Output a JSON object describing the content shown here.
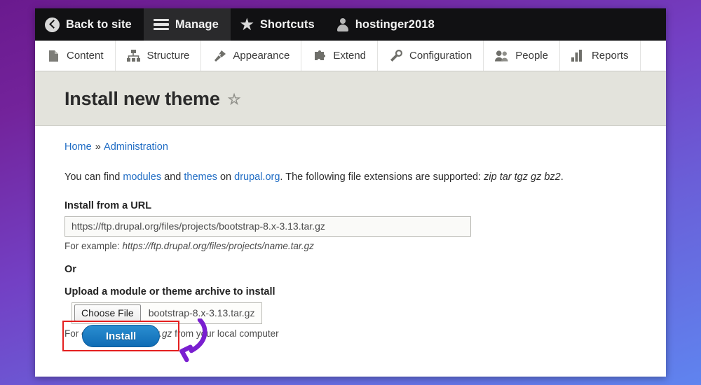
{
  "background": {
    "gradient_from": "#6a1a8e",
    "gradient_to": "#5f84ef"
  },
  "toolbar": {
    "items": [
      {
        "label": "Back to site",
        "icon": "back-arrow-icon",
        "active": false
      },
      {
        "label": "Manage",
        "icon": "hamburger-menu-icon",
        "active": true
      },
      {
        "label": "Shortcuts",
        "icon": "star-icon",
        "active": false
      },
      {
        "label": "hostinger2018",
        "icon": "user-account-icon",
        "active": false
      }
    ]
  },
  "admin_menu": {
    "items": [
      {
        "label": "Content",
        "icon": "document-icon"
      },
      {
        "label": "Structure",
        "icon": "sitemap-icon"
      },
      {
        "label": "Appearance",
        "icon": "paintbrush-icon"
      },
      {
        "label": "Extend",
        "icon": "puzzle-piece-icon"
      },
      {
        "label": "Configuration",
        "icon": "wrench-icon"
      },
      {
        "label": "People",
        "icon": "people-icon"
      },
      {
        "label": "Reports",
        "icon": "bar-chart-icon"
      }
    ]
  },
  "page": {
    "title": "Install new theme",
    "favorite_icon": "star-outline-icon"
  },
  "breadcrumb": {
    "home": "Home",
    "separator": "»",
    "current": "Administration"
  },
  "intro": {
    "part1": "You can find ",
    "link_modules": "modules",
    "part2": " and ",
    "link_themes": "themes",
    "part3": " on ",
    "link_drupal": "drupal.org",
    "part4": ". The following file extensions are supported: ",
    "extensions": "zip tar tgz gz bz2",
    "period": "."
  },
  "url_field": {
    "label": "Install from a URL",
    "value": "https://ftp.drupal.org/files/projects/bootstrap-8.x-3.13.tar.gz",
    "placeholder": "https://ftp.drupal.org/files/projects/name.tar.gz",
    "help_prefix": "For example: ",
    "help_example": "https://ftp.drupal.org/files/projects/name.tar.gz"
  },
  "or_label": "Or",
  "upload_field": {
    "label": "Upload a module or theme archive to install",
    "button_label": "Choose File",
    "filename": "bootstrap-8.x-3.13.tar.gz",
    "help_prefix": "For example: ",
    "help_example": "name.tar.gz",
    "help_suffix": " from your local computer"
  },
  "install_button": {
    "label": "Install",
    "highlight_color": "#e41f1f",
    "button_color": "#1a7cc2"
  },
  "annotation": {
    "arrow_color": "#7a1fd0",
    "type": "curved-arrow-pointing-to-install-button"
  }
}
